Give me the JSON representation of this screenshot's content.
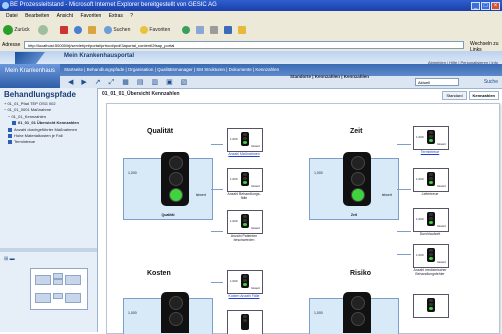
{
  "window": {
    "title": "BE Prozessleitstand - Microsoft Internet Explorer bereitgestellt von GESIC AG"
  },
  "menu": [
    "Datei",
    "Bearbeiten",
    "Ansicht",
    "Favoriten",
    "Extras",
    "?"
  ],
  "toolbar": {
    "back": "Zurück",
    "search": "Suchen",
    "favorites": "Favoriten"
  },
  "address": {
    "label": "Adresse",
    "url": "http://localhost:50000/irj/servlet/prt/portal/prtroot/pcd!3aportal_content!2fsap_portal",
    "go": "Wechseln zu",
    "links": "Links"
  },
  "portal": {
    "title": "Mein Krankenhausportal",
    "top_links": "Abmelden | Hilfe | Personalisieren | Info"
  },
  "nav": {
    "home": "Mein Krankenhaus",
    "items": "Startseite | Behandlungspfade | Organisation | Qualitätsmanager | SM Strukturen | Dokumente | Kennzahlen"
  },
  "subnav": {
    "links": "Standorte | Kennzahlen | Kennzahlen",
    "select": "Aktuell",
    "trail": "Suche"
  },
  "left": {
    "title": "Behandlungspfade",
    "tree": [
      {
        "label": "01_01_Pfad TEP OSG 002"
      },
      {
        "label": "01_01_0001 Maßnahme"
      },
      {
        "label": "01_01_Kennzahlen"
      },
      {
        "label": "01_01_01 Übersicht Kennzahlen"
      },
      {
        "label": "Anzahl durchgeführter Maßnahmen"
      },
      {
        "label": "Hohe Materialkosten je Fall"
      },
      {
        "label": "Termintreue"
      }
    ]
  },
  "content": {
    "title": "01_01_01_Übersicht Kennzahlen",
    "tab1": "Standard",
    "tab2": "Kennzahlen"
  },
  "sections": {
    "qualitaet": {
      "title": "Qualität",
      "value": "1,000",
      "unit": "Istwert",
      "caption": "Qualität",
      "items": [
        {
          "value": "1,000",
          "unit": "Istwert",
          "label": "Anzahl Maßnahmen"
        },
        {
          "value": "1,000",
          "unit": "Istwert",
          "label": "Anzahl Behandlungs-fälle"
        },
        {
          "value": "1,000",
          "unit": "Istwert",
          "label": "Anzahl Patienten beschwerden"
        }
      ]
    },
    "zeit": {
      "title": "Zeit",
      "value": "1,000",
      "unit": "Istwert",
      "caption": "Zeit",
      "items": [
        {
          "value": "1,000",
          "unit": "Istwert",
          "label": "Termintreue"
        },
        {
          "value": "1,000",
          "unit": "Istwert",
          "label": "Liefertreue"
        },
        {
          "value": "1,000",
          "unit": "Istwert",
          "label": "Durchlaufzeit"
        }
      ]
    },
    "kosten": {
      "title": "Kosten",
      "value": "1,000",
      "unit": "Istwert",
      "items": [
        {
          "value": "1,000",
          "unit": "Istwert",
          "label": "Kosten Anzahl Fälle"
        }
      ]
    },
    "risiko": {
      "title": "Risiko",
      "value": "1,000",
      "unit": "Istwert",
      "items": [
        {
          "value": "1,000",
          "unit": "Istwert",
          "label": "Anzahl medizinischer Behandlungsfehler"
        }
      ]
    }
  },
  "colors": {
    "accent": "#3b6bb2",
    "signal_green": "#3fd33f",
    "box_fill": "#d8eaf8"
  }
}
